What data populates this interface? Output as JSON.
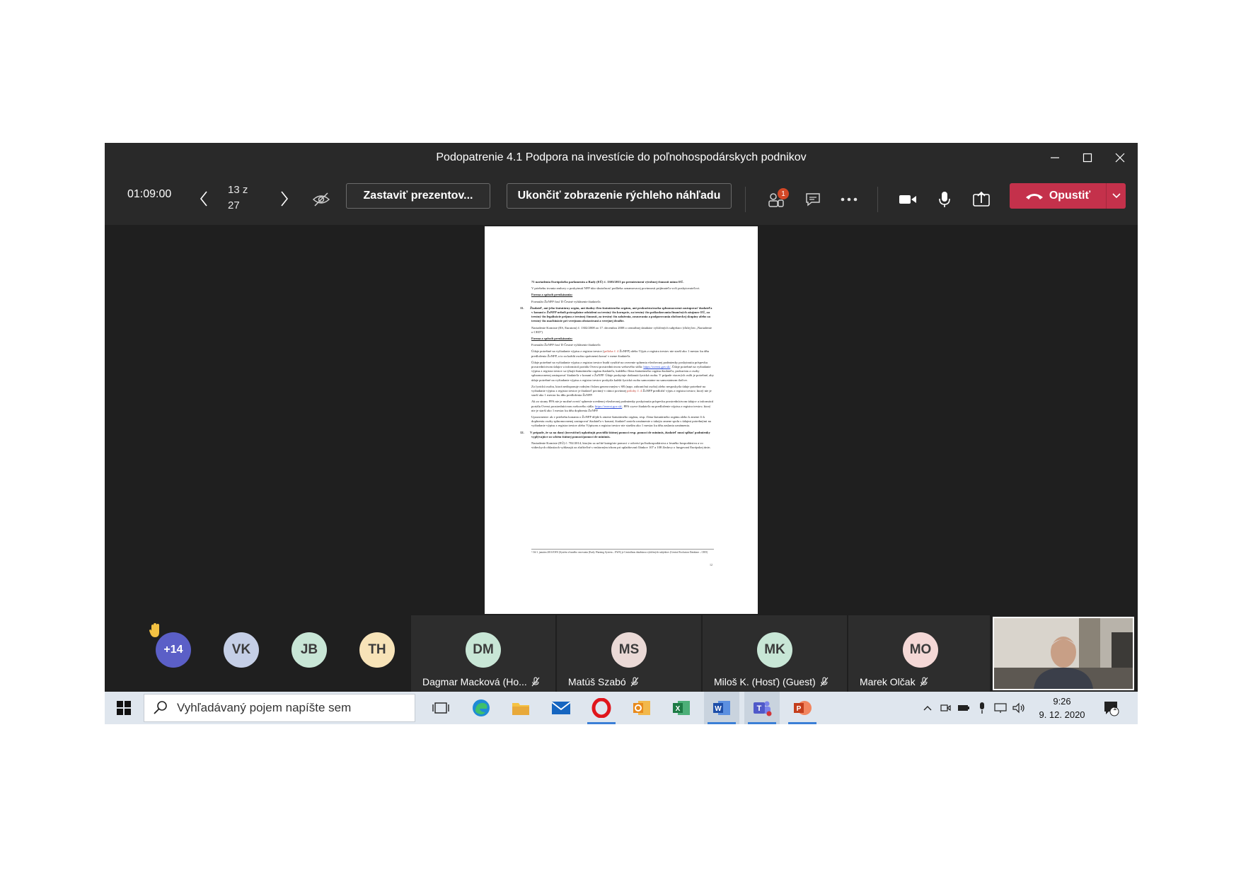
{
  "window": {
    "title": "Podopatrenie 4.1 Podpora na investície do poľnohospodárskych podnikov",
    "minimize_icon": "minimize-icon",
    "maximize_icon": "maximize-icon",
    "close_icon": "close-icon"
  },
  "toolbar": {
    "timer": "01:09:00",
    "page_counter_line1": "13 z",
    "page_counter_line2": "27",
    "stop_presenting_label": "Zastaviť prezentov...",
    "end_preview_label": "Ukončiť zobrazenie rýchleho náhľadu",
    "participants_badge": "1",
    "leave_label": "Opustiť",
    "colors": {
      "leave": "#c4314b",
      "badge": "#d24726"
    }
  },
  "document": {
    "p1": "71 nariadenia Európskeho parlamentu a Rady (EÚ) č. 1303/2013 po premiestnení výrobnej činnosti mimo EÚ.",
    "p2": "V priebehu trvania zmluvy o poskytnutí NFP túto skutočnosť podlieha oznamovacej povinnosti prijímateľa voči poskytovateľovi.",
    "h1": "Forma a spôsob preukázania:",
    "p3": "Formulár ŽoNFP časť D Čestné vyhlásenie žiadateľa",
    "n11": "11.",
    "p4": "Žiadateľ, ani jeho štatutárny orgán, ani žiadny člen štatutárneho orgánu, ani prokurista/osoba splnomocnená zastupovať žiadateľa v konaní o ŽoNFP neboli právoplatne odsúdení za trestný čin korupcie, za trestný čin poškodzovania finančných záujmov EÚ, za trestný čin legalizácie príjmu z trestnej činnosti, za trestný čin založenia, zosnovania a podporovania zločineckej skupiny alebo za trestný čin machinácie pri verejnom obstarávaní a verejnej dražbe.",
    "p5": "Nariadenie Komisie (ES, Euratom) č. 1302/2008 zo 17. decembra 2008 o centrálnej databáze vylúčených subjektov (ďalej len „Nariadenie o CED\")",
    "h2": "Forma a spôsob preukázania:",
    "p6": "Formulár ŽoNFP časť D Čestné vyhlásenie žiadateľa",
    "p7a": "Údaje potrebné na vyžiadanie výpisu z registra trestov (",
    "p7red": "príloha č. 4",
    "p7b": " ŽoNFP) alebo Výpis z registra trestov nie starší ako 1 mesiac ku dňu predloženia ŽoNFP, a to za každú osobu oprávnenú konať v mene žiadateľa.",
    "p8a": "Údaje potrebné na vyžiadanie výpisu z registra trestov budú využité na overenie splnenia všeobecnej podmienky poskytnutia príspevku prostredníctvom údajov a informácií portálu Oversi prostredníctvom webového sídla: ",
    "p8link": "https://oversi.gov.sk/",
    "p8b": ". Údaje potrebné na vyžiadanie výpisu z registra trestov sa týkajú štatutárneho orgánu žiadateľa, každého člena štatutárneho orgánu žiadateľa, prokuristu a osoby splnomocnenej zastupovať žiadateľa v konaní o ŽoNFP. Údaje poskytuje dotknutá fyzická osoba. V prípade viacerých osôb je potrebné, aby údaje potrebné na vyžiadanie výpisu z registra trestov poskytla každá fyzická osoba samostatne na samostatnom tlačive.",
    "p9a": "Za fyzickú osobu, ktorá nedisponuje rodným číslom generovaným v SR (napr. zahraničná osoba) alebo nesposkytla údaje potrebné na vyžiadanie výpisu z registra trestov je žiadateľ povinný v rámci povinnej ",
    "p9red": "prílohy č. 4",
    "p9b": " ŽoNFP predložiť výpis z registra trestov, ktorý nie je starší ako 1 mesiac ku dňu predloženia ŽoNFP.",
    "p10a": "Ak zo strany PPA nie je možné overiť splnenie uvedenej všeobecnej podmienky poskytnutia príspevku prostredníctvom údajov a informácií portálu Oversi prostredníctvom webového sídla: ",
    "p10link": "https://oversi.gov.sk/",
    "p10b": ", PPA vyzve žiadateľa na predloženie výpisu z registra trestov, ktorý nie je starší ako 1 mesiac ku dňu doplnenia ŽoNFP.",
    "p11": "Upozornenie: ak v priebehu konania o ŽoNFP dôjde k zmene štatutárneho orgánu, resp. člena štatutárneho orgánu alebo k zmene či k doplneniu osoby splnomocnenej zastupovať žiadateľa v konaní, žiadateľ zasiela oznámenie o takejto zmene spolu s údajmi potrebnými na vyžiadanie výpisu z registra trestov alebo Výpisom z registra trestov nie starším ako 1 mesiac ku dňu zaslania oznámenia.",
    "n12": "12.",
    "p12": "V prípade, že sa na daný (investičné) uplatňujú pravidlá štátnej pomoci resp. pomoci de minimis, žiadateľ musí spĺňať podmienky vyplývajúce zo schém štátnej pomoci/pomoci de minimis.",
    "p13": "Nariadenie Komisie (EÚ) č. 702/2014, ktorým sa určité kategórie pomoci v odvetví poľnohospodárstva a lesného hospodárstva a vo vidieckych oblastiach vyhlasujú za zlučiteľné s vnútorným trhom pri uplatňovaní článkov 107 a 108 Zmluvy o fungovaní Európskej únie;",
    "footnote": "¹ Od 1. januára 2016 EWS (Systém včasného varovania (Early Warning System – EWS) je Centrálnou databázou vylúčených subjektov (Central Exclusion Database – CED)",
    "page_number": "12"
  },
  "roster": {
    "overflow": "+14",
    "raised_hand_icon": "raised-hand-icon",
    "small_avatars": [
      {
        "initials": "VK",
        "color": "#c5cfe6"
      },
      {
        "initials": "JB",
        "color": "#c8e6d6"
      },
      {
        "initials": "TH",
        "color": "#f7e3b8"
      }
    ],
    "tiles": [
      {
        "initials": "DM",
        "name": "Dagmar Macková (Ho...",
        "color": "#c8e6d6"
      },
      {
        "initials": "MS",
        "name": "Matúš Szabó",
        "color": "#ead9d6"
      },
      {
        "initials": "MK",
        "name": "Miloš K. (Hosť) (Guest)",
        "color": "#c8e6d6"
      },
      {
        "initials": "MO",
        "name": "Marek Olčak",
        "color": "#f4d8d6"
      }
    ]
  },
  "taskbar": {
    "search_placeholder": "Vyhľadávaný pojem napíšte sem",
    "time": "9:26",
    "date": "9. 12. 2020",
    "notification_count": "1"
  }
}
